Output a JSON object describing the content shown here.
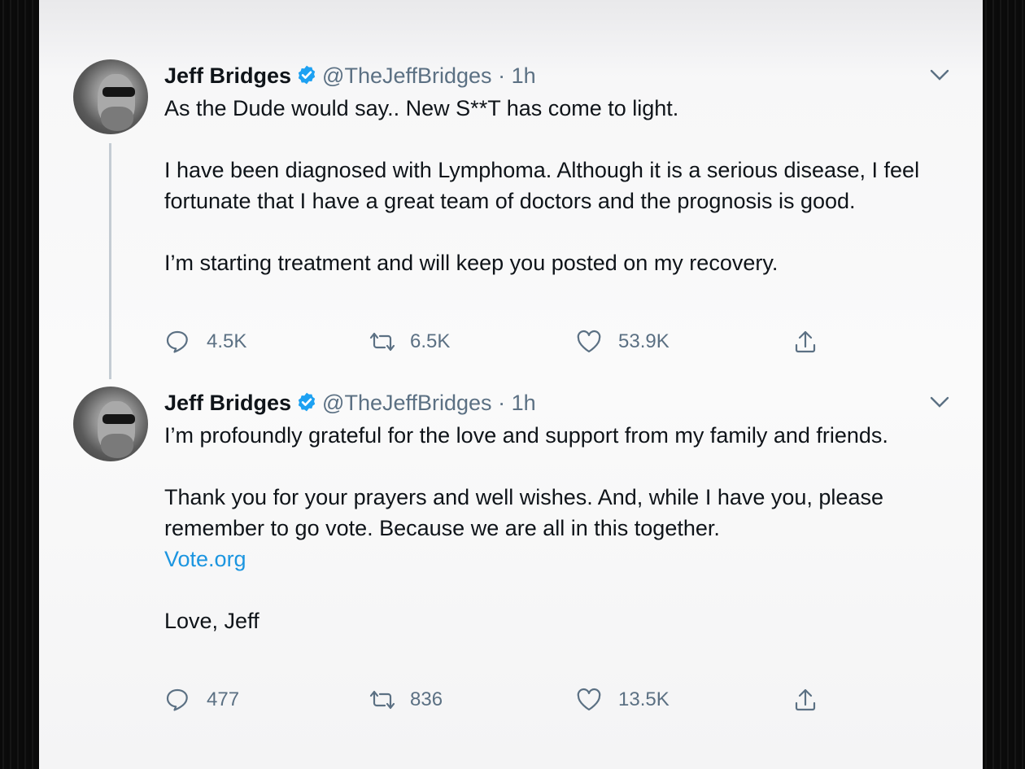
{
  "colors": {
    "text": "#0f1419",
    "secondary": "#5b7083",
    "link": "#1b95e0",
    "verified": "#1da1f2"
  },
  "tweets": [
    {
      "author": {
        "name": "Jeff Bridges",
        "handle": "@TheJeffBridges",
        "verified": true,
        "avatar_icon": "avatar"
      },
      "separator": "·",
      "time": "1h",
      "body": {
        "p1": "As the Dude would say.. New S**T has come to light.",
        "p2": "I have been diagnosed with Lymphoma. Although it is a serious disease, I feel fortunate that I have a great team of doctors and the prognosis is good.",
        "p3": "I’m starting treatment and will keep you posted on my recovery."
      },
      "stats": {
        "replies": "4.5K",
        "retweets": "6.5K",
        "likes": "53.9K"
      }
    },
    {
      "author": {
        "name": "Jeff Bridges",
        "handle": "@TheJeffBridges",
        "verified": true,
        "avatar_icon": "avatar"
      },
      "separator": "·",
      "time": "1h",
      "body": {
        "p1": "I’m profoundly grateful for the love and support from my family and friends.",
        "p2": "Thank you for your prayers and well wishes.  And, while I have you, please remember to go vote. Because we are all in this together.",
        "link": "Vote.org",
        "p3": "Love, Jeff"
      },
      "stats": {
        "replies": "477",
        "retweets": "836",
        "likes": "13.5K"
      }
    }
  ],
  "icons": [
    "reply-icon",
    "retweet-icon",
    "like-icon",
    "share-icon",
    "chevron-down-icon",
    "verified-badge-icon"
  ]
}
